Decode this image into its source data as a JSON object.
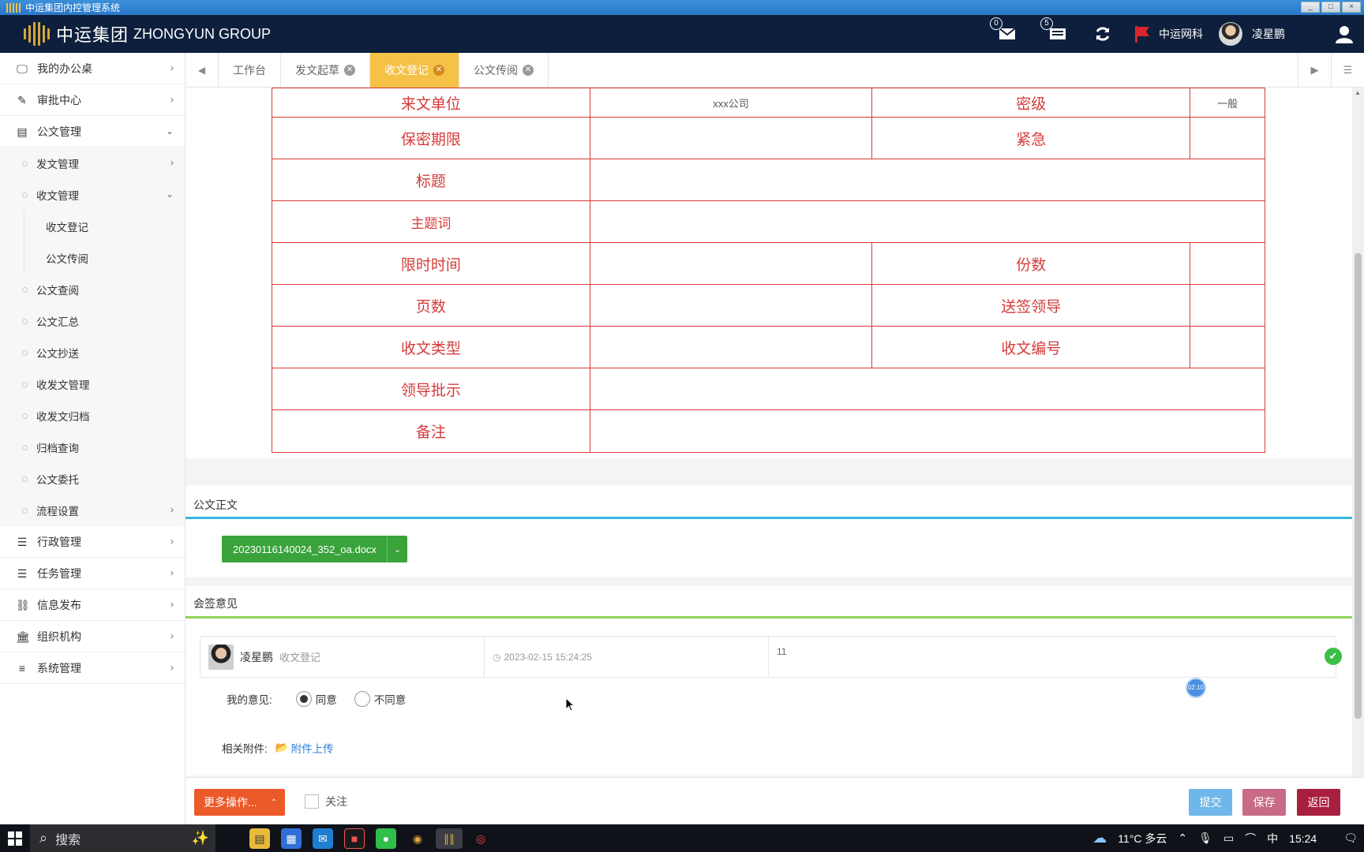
{
  "window": {
    "title": "中运集团内控管理系统",
    "controls": [
      "_",
      "□",
      "×"
    ]
  },
  "header": {
    "brand_cn": "中运集团",
    "brand_en": "ZHONGYUN GROUP",
    "mail_count": "0",
    "notice_count": "5",
    "org_name": "中运网科",
    "user_name": "凌星鹏"
  },
  "sidebar": {
    "items": [
      {
        "label": "我的办公桌",
        "icon": "monitor-icon"
      },
      {
        "label": "审批中心",
        "icon": "edit-icon"
      },
      {
        "label": "公文管理",
        "icon": "briefcase-icon"
      },
      {
        "label": "行政管理",
        "icon": "server-icon"
      },
      {
        "label": "任务管理",
        "icon": "tasks-icon"
      },
      {
        "label": "信息发布",
        "icon": "link-icon"
      },
      {
        "label": "组织机构",
        "icon": "bank-icon"
      },
      {
        "label": "系统管理",
        "icon": "menu-icon"
      }
    ],
    "gongwen_sub": [
      "发文管理",
      "收文管理",
      "公文查阅",
      "公文汇总",
      "公文抄送",
      "收发文管理",
      "收发文归档",
      "归档查询",
      "公文委托",
      "流程设置"
    ],
    "shouwen_sub": [
      "收文登记",
      "公文传阅"
    ]
  },
  "tabs": [
    {
      "label": "工作台",
      "closable": false,
      "active": false
    },
    {
      "label": "发文起草",
      "closable": true,
      "active": false
    },
    {
      "label": "收文登记",
      "closable": true,
      "active": true
    },
    {
      "label": "公文传阅",
      "closable": true,
      "active": false
    }
  ],
  "form": {
    "labels": {
      "laiwen_unit": "来文单位",
      "miji": "密级",
      "baomi_qixian": "保密期限",
      "jinji": "紧急",
      "biaoti": "标题",
      "zhutici": "主题词",
      "xianshi_time": "限时时间",
      "fenshu": "份数",
      "yeshu": "页数",
      "songqian_leader": "送签领导",
      "shouwen_type": "收文类型",
      "shouwen_no": "收文编号",
      "leader_pishi": "领导批示",
      "beizhu": "备注"
    },
    "values": {
      "laiwen_unit": "xxx公司",
      "miji": "一般"
    }
  },
  "sections": {
    "body_title": "公文正文",
    "doc_file": "20230116140024_352_oa.docx",
    "opinion_title": "会签意见"
  },
  "opinion_entry": {
    "user": "凌星鹏",
    "step": "收文登记",
    "time": "2023-02-15 15:24:25",
    "content": "11"
  },
  "my_opinion": {
    "label": "我的意见:",
    "agree": "同意",
    "disagree": "不同意",
    "selected": "同意",
    "attach_label": "相关附件:",
    "attach_link": "附件上传"
  },
  "footer": {
    "more_ops": "更多操作...",
    "follow": "关注",
    "submit": "提交",
    "save": "保存",
    "back": "返回",
    "colors": {
      "more": "#ec5a2a",
      "submit": "#6fb7ea",
      "save": "#c76b87",
      "back": "#a81e3f"
    }
  },
  "floating_timer": "02:10",
  "taskbar": {
    "search": "搜索",
    "weather": "11°C 多云",
    "ime": "中",
    "time": "15:24"
  }
}
